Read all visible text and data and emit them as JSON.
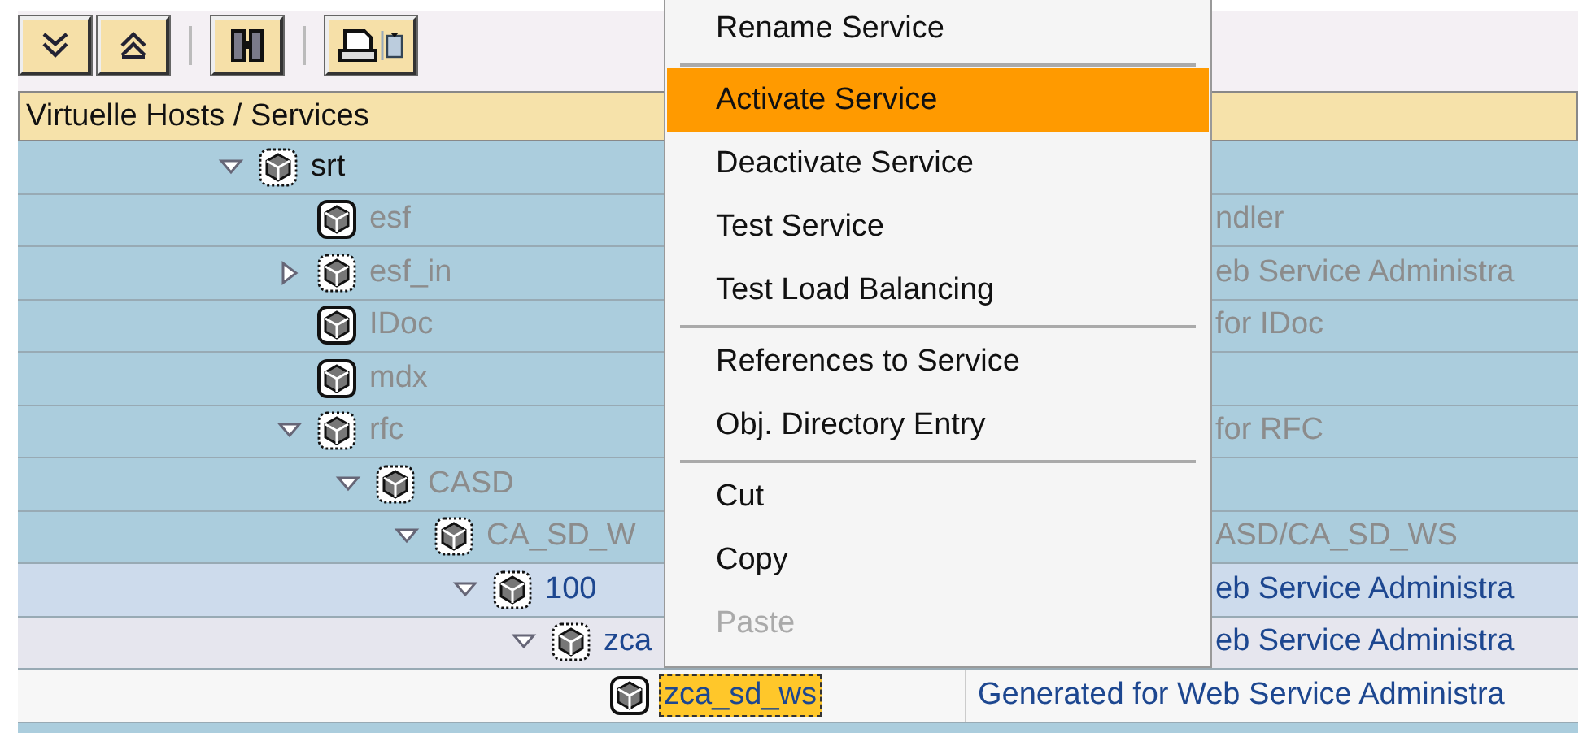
{
  "toolbar": {
    "buttons": [
      {
        "kind": "expand_all"
      },
      {
        "kind": "collapse_all"
      },
      {
        "kind": "find"
      },
      {
        "kind": "print"
      }
    ]
  },
  "header": "Virtuelle Hosts / Services",
  "tree": [
    {
      "name": "srt",
      "kind": "branch",
      "expanded": true,
      "greyed": false,
      "active": false,
      "selected": false,
      "color": "#abcddd",
      "children": [
        {
          "name": "esf",
          "kind": "leaf",
          "greyed": true,
          "active": false,
          "selected": false,
          "color": "#abcddd",
          "description": "ndler",
          "cut_by_menu": true
        },
        {
          "name": "esf_in",
          "kind": "branch",
          "expanded": false,
          "greyed": true,
          "active": false,
          "selected": false,
          "color": "#abcddd",
          "description": "eb Service Administra",
          "cut_by_menu": true
        },
        {
          "name": "IDoc",
          "kind": "leaf",
          "greyed": true,
          "active": false,
          "selected": false,
          "color": "#abcddd",
          "description": "for IDoc",
          "cut_by_menu": true
        },
        {
          "name": "mdx",
          "kind": "leaf",
          "greyed": true,
          "active": false,
          "selected": false,
          "color": "#abcddd"
        },
        {
          "name": "rfc",
          "kind": "branch",
          "expanded": true,
          "greyed": true,
          "active": false,
          "selected": false,
          "color": "#abcddd",
          "description": "for RFC",
          "cut_by_menu": true,
          "children": [
            {
              "name": "CASD",
              "kind": "branch",
              "expanded": true,
              "greyed": true,
              "active": false,
              "selected": false,
              "color": "#abcddd",
              "children": [
                {
                  "name": "CA_SD_W",
                  "kind": "branch",
                  "expanded": true,
                  "greyed": true,
                  "active": false,
                  "selected": false,
                  "color": "#abcddd",
                  "description": "ASD/CA_SD_WS",
                  "cut_by_menu": true,
                  "children": [
                    {
                      "name": "100",
                      "kind": "branch",
                      "expanded": true,
                      "greyed": false,
                      "active": true,
                      "selected": false,
                      "color": "#cddbec",
                      "description": "eb Service Administra",
                      "cut_by_menu": true,
                      "children": [
                        {
                          "name": "zca",
                          "kind": "branch",
                          "expanded": true,
                          "greyed": false,
                          "active": true,
                          "selected": false,
                          "color": "#e6e6ee",
                          "description": "eb Service Administra",
                          "cut_by_menu": true,
                          "children": [
                            {
                              "name": "zca_sd_ws",
                              "kind": "leaf",
                              "greyed": false,
                              "active": true,
                              "selected": true,
                              "color": "#f7f7f7",
                              "description": "Generated for Web Service Administra",
                              "cut_by_menu": false
                            }
                          ]
                        }
                      ]
                    }
                  ]
                }
              ]
            }
          ]
        }
      ]
    }
  ],
  "context_menu": {
    "groups": [
      {
        "items": [
          {
            "label": "Rename Service",
            "selected": false,
            "disabled": false
          }
        ]
      },
      {
        "items": [
          {
            "label": "Activate Service",
            "selected": true,
            "disabled": false
          },
          {
            "label": "Deactivate Service",
            "selected": false,
            "disabled": false
          },
          {
            "label": "Test Service",
            "selected": false,
            "disabled": false
          },
          {
            "label": "Test Load Balancing",
            "selected": false,
            "disabled": false
          }
        ]
      },
      {
        "items": [
          {
            "label": "References to Service",
            "selected": false,
            "disabled": false
          },
          {
            "label": "Obj. Directory Entry",
            "selected": false,
            "disabled": false
          }
        ]
      },
      {
        "items": [
          {
            "label": "Cut",
            "selected": false,
            "disabled": false
          },
          {
            "label": "Copy",
            "selected": false,
            "disabled": false
          },
          {
            "label": "Paste",
            "selected": false,
            "disabled": true
          }
        ]
      }
    ]
  }
}
